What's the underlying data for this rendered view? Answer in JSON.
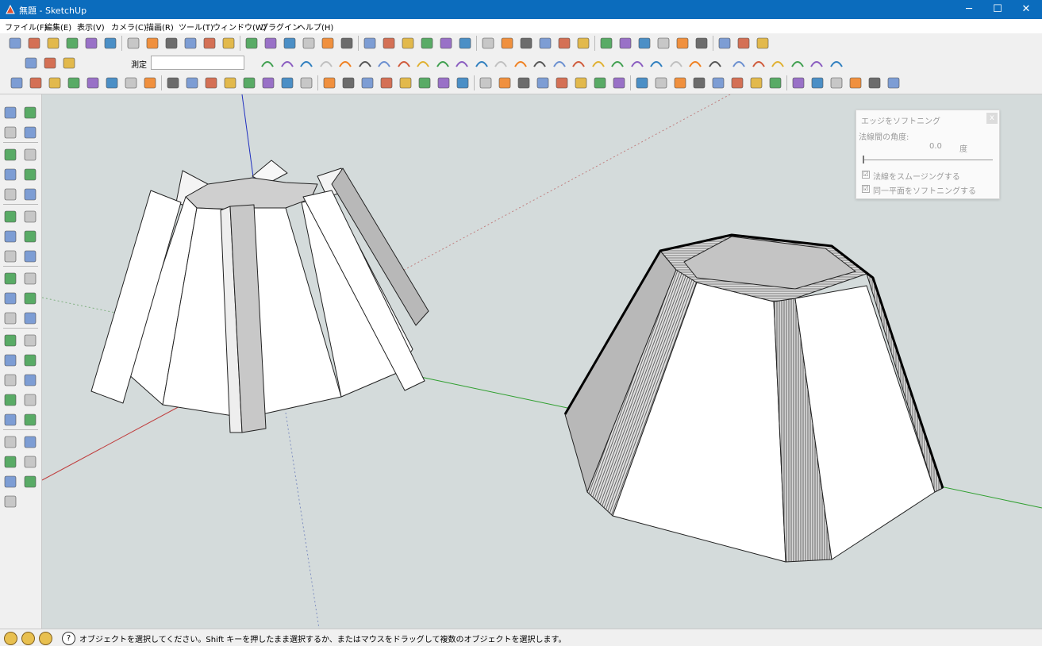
{
  "window": {
    "title": "無題 - SketchUp",
    "minimize": "─",
    "maximize": "☐",
    "close": "✕"
  },
  "menu": [
    "ファイル(F)",
    "編集(E)",
    "表示(V)",
    "カメラ(C)",
    "描画(R)",
    "ツール(T)",
    "ウィンドウ(W)",
    "プラグイン",
    "ヘルプ(H)"
  ],
  "measurements": {
    "label": "測定",
    "value": ""
  },
  "soften_panel": {
    "title": "エッジをソフトニング",
    "close": "x",
    "angle_label": "法線間の角度:",
    "angle_value": "0.0",
    "angle_unit": "度",
    "smooth_normals_label": "法線をスムージングする",
    "smooth_normals_checked": "☑",
    "coplanar_label": "同一平面をソフトニングする",
    "coplanar_checked": "☑"
  },
  "status": {
    "help_icon": "?",
    "message": "オブジェクトを選択してください。Shift キーを押したまま選択するか、またはマウスをドラッグして複数のオブジェクトを選択します。"
  },
  "colors": {
    "titlebar": "#0b6cbd",
    "viewport_bg": "#d4dbdb",
    "axis_red": "#c04040",
    "axis_green": "#2f9f2f",
    "axis_blue": "#2030c0"
  },
  "icons": {
    "row1": [
      "new-file-icon",
      "open-icon",
      "save-icon",
      "cut-icon",
      "copy-icon",
      "paste-icon",
      "erase-icon",
      "undo-icon",
      "redo-icon",
      "print-icon",
      "model-info-icon",
      "iso-view-icon",
      "top-view-icon",
      "front-view-icon",
      "right-view-icon",
      "back-view-icon",
      "left-view-icon",
      "xray-icon",
      "wireframe-icon",
      "hidden-line-icon",
      "shaded-icon",
      "shaded-texture-icon",
      "monochrome-icon",
      "color-palette-icon",
      "pointer-icon",
      "stairs-icon",
      "mirror-icon",
      "flip-icon",
      "axis-icon",
      "flip-vertical-icon",
      "flip-red-icon",
      "scale-icon",
      "fit-icon",
      "rotate-ccw-icon",
      "rotate-cw-icon",
      "eraser-tool-icon",
      "glasses-icon",
      "lock-icon",
      "dome-icon"
    ],
    "row2": [
      "section-plane-icon",
      "display-section-icon",
      "section-cuts-icon",
      "curve-1-icon",
      "curve-2-icon",
      "curve-3-icon",
      "curve-4-icon",
      "curve-5-icon",
      "curve-6-icon",
      "curve-7-icon",
      "curve-8-icon",
      "bezier-icon",
      "spline-icon",
      "polyline-icon",
      "arc-icon",
      "freehand-icon",
      "arc2-icon",
      "rect-icon",
      "spiral-icon",
      "arc3-icon",
      "zigzag-icon",
      "hook-icon",
      "curve-9-icon",
      "arc4-icon",
      "polyline2-icon",
      "polygon-icon",
      "wrench-icon",
      "circle-icon",
      "sector-icon",
      "bridge-icon",
      "box-1-icon",
      "box-2-icon",
      "box-3-icon"
    ],
    "row3": [
      "play-icon",
      "rewind-icon",
      "ui-icon",
      "plugin-icon",
      "record-icon",
      "camera-icon",
      "path-icon",
      "left-arrow-icon",
      "double-left-icon",
      "refresh-icon",
      "line-icon",
      "sync-icon",
      "pencil-icon",
      "loop-icon",
      "finger-icon",
      "ellipse-icon",
      "cube-icon",
      "twist-icon",
      "pin-icon",
      "cross-icon",
      "box-solid-icon",
      "cylinder-flat-icon",
      "cylinder-icon",
      "cone-icon",
      "tube-icon",
      "slab-icon",
      "torus-icon",
      "tube2-icon",
      "bowl-icon",
      "align-left-icon",
      "align-center-icon",
      "align-right-icon",
      "distribute-icon",
      "stack-icon",
      "tee-icon",
      "arrange-icon",
      "arrange2-icon",
      "arrange3-icon",
      "panel-1-icon",
      "panel-2-icon",
      "film-icon",
      "frame-icon",
      "diamond-icon",
      "pyramid-icon",
      "palette-icon",
      "dots-icon"
    ],
    "left": [
      "select-icon",
      "component-icon",
      "paint-bucket-icon",
      "eraser-icon",
      "rectangle-icon",
      "pencil-icon",
      "circle-icon",
      "arc-icon",
      "polygon-icon",
      "freehand-icon",
      "move-icon",
      "push-pull-icon",
      "rotate-icon",
      "follow-me-icon",
      "scale-icon",
      "offset-icon",
      "tape-measure-icon",
      "dimension-icon",
      "protractor-icon",
      "text-icon",
      "axes-icon",
      "3d-text-icon",
      "orbit-icon",
      "pan-icon",
      "zoom-icon",
      "zoom-window-icon",
      "zoom-extents-icon",
      "previous-view-icon",
      "position-camera-icon",
      "look-around-icon",
      "walk-icon",
      "section-icon",
      "sandbox-1-icon",
      "sandbox-2-icon",
      "sandbox-3-icon",
      "sandbox-4-icon",
      "sandbox-5-icon",
      "sandbox-6-icon",
      "sandbox-7-icon"
    ],
    "status": [
      "geo-location-icon",
      "credits-icon",
      "user-icon"
    ]
  }
}
